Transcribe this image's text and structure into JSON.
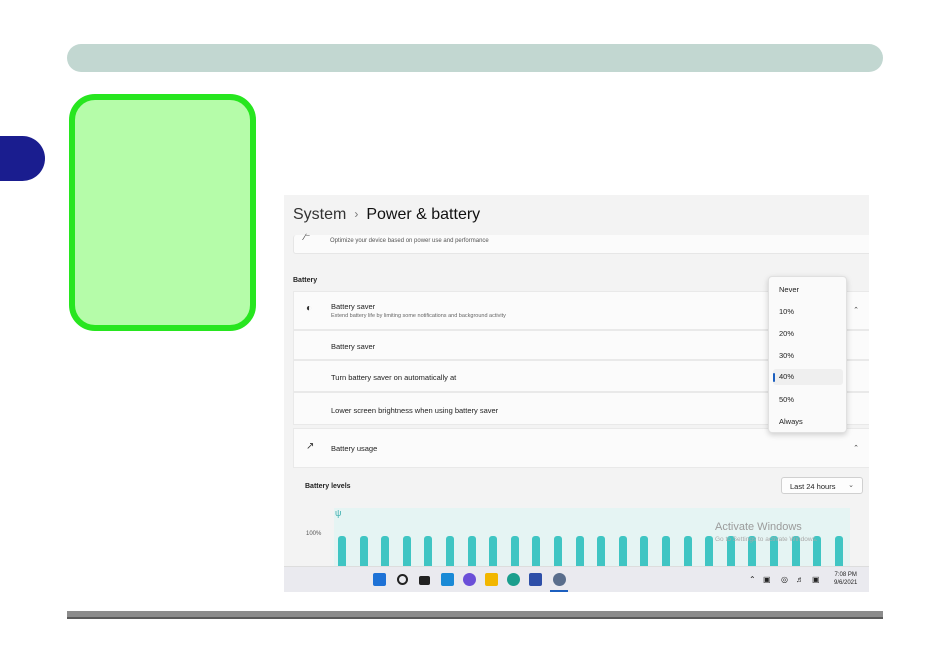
{
  "breadcrumb": {
    "parent": "System",
    "separator": "›",
    "current": "Power & battery"
  },
  "power_mode": {
    "subtitle": "Optimize your device based on power use and performance"
  },
  "battery_section": {
    "label": "Battery"
  },
  "battery_saver": {
    "title": "Battery saver",
    "subtitle": "Extend battery life by limiting some notifications and background activity",
    "row_saver": "Battery saver",
    "row_auto": "Turn battery saver on automatically at",
    "row_brightness": "Lower screen brightness when using battery saver"
  },
  "dropdown": {
    "options": [
      "Never",
      "10%",
      "20%",
      "30%",
      "40%",
      "50%",
      "Always"
    ],
    "selected": "40%"
  },
  "battery_usage": {
    "title": "Battery usage"
  },
  "battery_levels": {
    "label": "Battery levels",
    "range": "Last 24 hours",
    "y_label": "100%",
    "bar_count": 24
  },
  "watermark": {
    "title": "Activate Windows",
    "subtitle": "Go to Settings to activate Windows."
  },
  "taskbar": {
    "icons": [
      "windows-start-icon",
      "search-icon",
      "task-view-icon",
      "widgets-icon",
      "chat-icon",
      "file-explorer-icon",
      "edge-icon",
      "store-icon",
      "settings-icon"
    ],
    "time": "7:08 PM",
    "date": "9/6/2021"
  },
  "colors": {
    "accent": "#1c5fbf",
    "bar": "#3fc5c3",
    "callout_fill": "#b5fca9",
    "callout_border": "#27e61f",
    "tab": "#1a1d8f"
  }
}
